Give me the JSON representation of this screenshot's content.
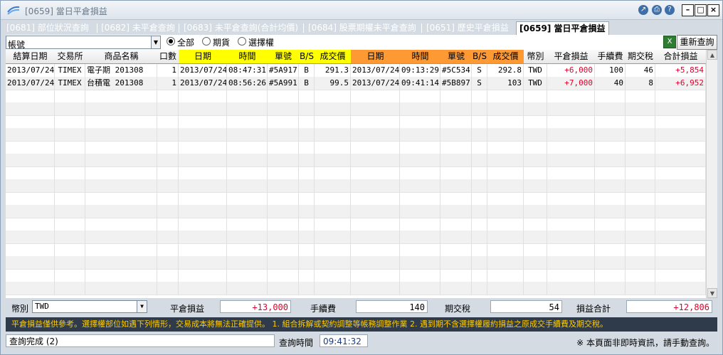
{
  "window": {
    "title": "[0659] 當日平倉損益"
  },
  "tabs": [
    {
      "label": "[0681] 部位狀況查詢"
    },
    {
      "label": "[0682] 未平倉查詢"
    },
    {
      "label": "[0683] 未平倉查詢(合計均價)"
    },
    {
      "label": "[0684] 股票期權未平倉查詢"
    },
    {
      "label": "[0651] 歷史平倉損益"
    },
    {
      "label": "[0659] 當日平倉損益"
    }
  ],
  "filter": {
    "account_label": "帳號",
    "options": [
      "全部",
      "期貨",
      "選擇權"
    ],
    "refresh_label": "重新查詢",
    "excel_icon": "X"
  },
  "table": {
    "headers": [
      "結算日期",
      "交易所",
      "商品名稱",
      "口數",
      "日期",
      "時間",
      "單號",
      "B/S",
      "成交價",
      "日期",
      "時間",
      "單號",
      "B/S",
      "成交價",
      "幣別",
      "平倉損益",
      "手續費",
      "期交稅",
      "合計損益"
    ],
    "rows": [
      [
        "2013/07/24",
        "TIMEX",
        "電子期 201308",
        "1",
        "2013/07/24",
        "08:47:31",
        "#5A917",
        "B",
        "291.3",
        "2013/07/24",
        "09:13:29",
        "#5C534",
        "S",
        "292.8",
        "TWD",
        "+6,000",
        "100",
        "46",
        "+5,854"
      ],
      [
        "2013/07/24",
        "TIMEX",
        "台積電 201308",
        "1",
        "2013/07/24",
        "08:56:26",
        "#5A991",
        "B",
        "99.5",
        "2013/07/24",
        "09:41:14",
        "#5B897",
        "S",
        "103",
        "TWD",
        "+7,000",
        "40",
        "8",
        "+6,952"
      ]
    ]
  },
  "summary": {
    "currency_label": "幣別",
    "currency_value": "TWD",
    "pnl_label": "平倉損益",
    "pnl_value": "+13,000",
    "fee_label": "手續費",
    "fee_value": "140",
    "tax_label": "期交稅",
    "tax_value": "54",
    "total_label": "損益合計",
    "total_value": "+12,806"
  },
  "notice": "平倉損益僅供參考。選擇權部位如遇下列情形，交易成本將無法正確提供。 1. 組合拆解或契約調整等帳務調整作業 2. 遇到期不含選擇權履約損益之原成交手續費及期交稅。",
  "status": {
    "message": "查詢完成 (2)",
    "time_label": "查詢時間",
    "time_value": "09:41:32",
    "right_note": "※ 本頁面非即時資訊，請手動查詢。"
  }
}
